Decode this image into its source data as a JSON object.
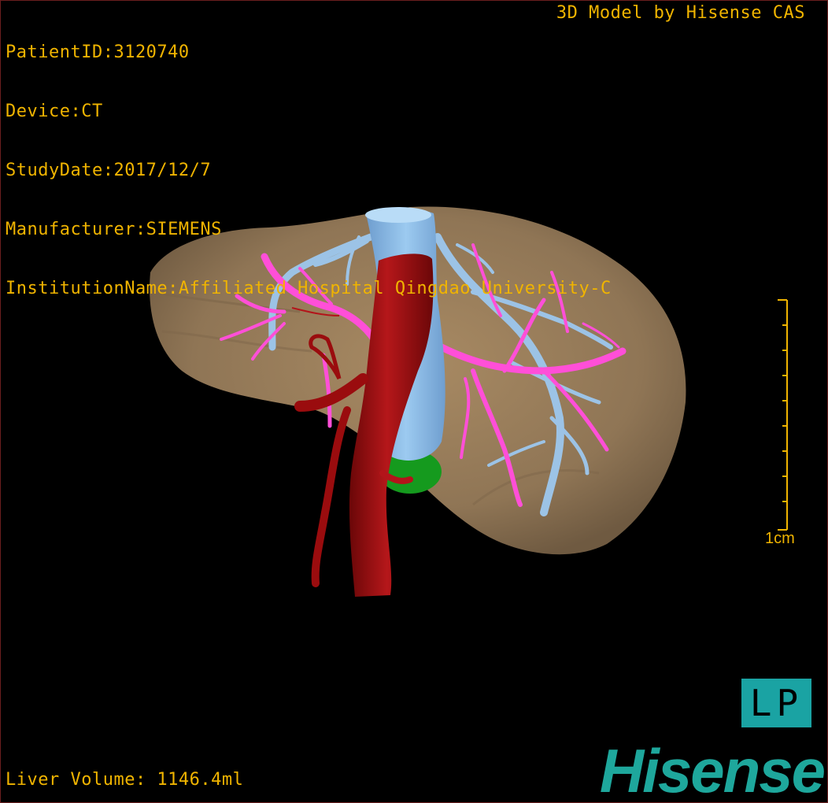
{
  "viewer": {
    "patient_id": "PatientID:3120740",
    "device": "Device:CT",
    "study_date": "StudyDate:2017/12/7",
    "manufacturer": "Manufacturer:SIEMENS",
    "institution": "InstitutionName:Affiliated Hospital Qingdao University-C",
    "model_credit": "3D Model by Hisense CAS",
    "liver_volume": "Liver Volume: 1146.4ml",
    "scale_label": "1cm",
    "orientation_label": "LP",
    "brand": "Hisense"
  },
  "colors": {
    "overlay_text": "#f0b400",
    "liver": "#8f7555",
    "portal_vein": "#ff4fd8",
    "hepatic_vein": "#9cc3e6",
    "inferior_vena_cava": "#8fbde6",
    "artery": "#a00d10",
    "gallbladder": "#159a1e",
    "brand": "#1ea79c"
  }
}
